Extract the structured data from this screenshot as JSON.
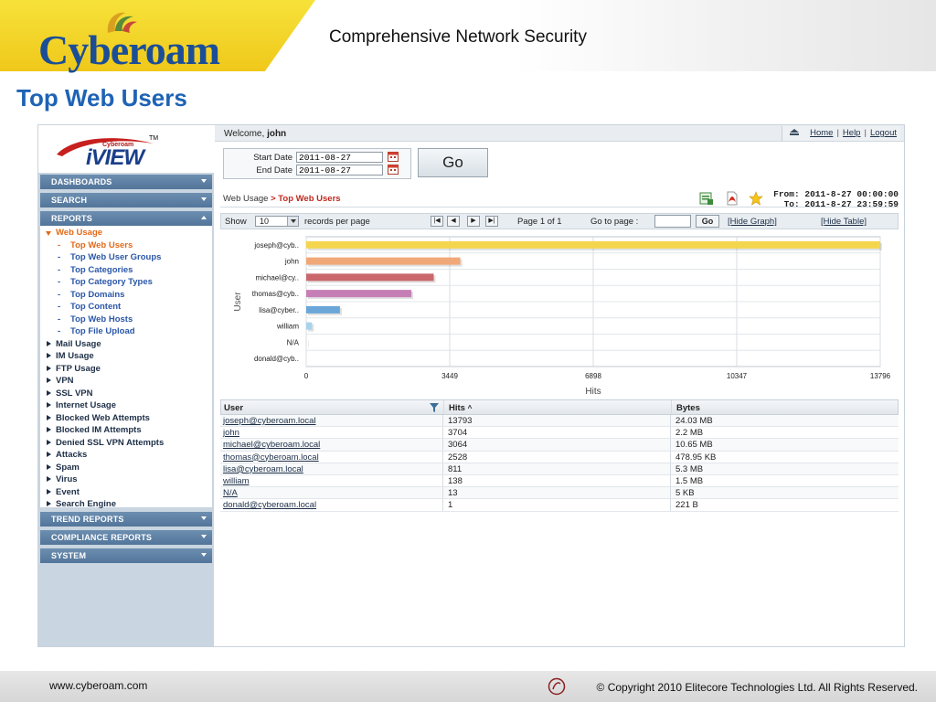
{
  "slide": {
    "brand": "Cyberoam",
    "tagline": "Comprehensive Network Security",
    "title": "Top Web Users",
    "footer_url": "www.cyberoam.com",
    "footer_copyright": "© Copyright 2010 Elitecore Technologies Ltd. All Rights Reserved.",
    "brand_color": "#1b4e97",
    "accent_color": "#efc81a"
  },
  "app": {
    "logo_small": "Cyberoam",
    "logo_main": "iVIEW",
    "logo_tm": "TM",
    "welcome_prefix": "Welcome, ",
    "user": "john",
    "links": {
      "home": "Home",
      "help": "Help",
      "logout": "Logout",
      "sep": "|"
    }
  },
  "sidebar": {
    "sections_top": [
      {
        "label": "DASHBOARDS"
      },
      {
        "label": "SEARCH"
      },
      {
        "label": "REPORTS"
      }
    ],
    "tree": [
      {
        "label": "Web Usage",
        "open": true
      },
      {
        "label": "Top Web Users",
        "sub": true,
        "active": true
      },
      {
        "label": "Top Web User Groups",
        "sub": true
      },
      {
        "label": "Top Categories",
        "sub": true
      },
      {
        "label": "Top Category Types",
        "sub": true
      },
      {
        "label": "Top Domains",
        "sub": true
      },
      {
        "label": "Top Content",
        "sub": true
      },
      {
        "label": "Top Web Hosts",
        "sub": true
      },
      {
        "label": "Top File Upload",
        "sub": true
      },
      {
        "label": "Mail Usage"
      },
      {
        "label": "IM Usage"
      },
      {
        "label": "FTP Usage"
      },
      {
        "label": "VPN"
      },
      {
        "label": "SSL VPN"
      },
      {
        "label": "Internet Usage"
      },
      {
        "label": "Blocked Web Attempts"
      },
      {
        "label": "Blocked IM Attempts"
      },
      {
        "label": "Denied SSL VPN Attempts"
      },
      {
        "label": "Attacks"
      },
      {
        "label": "Spam"
      },
      {
        "label": "Virus"
      },
      {
        "label": "Event"
      },
      {
        "label": "Search Engine"
      }
    ],
    "sections_bottom": [
      {
        "label": "TREND REPORTS"
      },
      {
        "label": "COMPLIANCE REPORTS"
      },
      {
        "label": "SYSTEM"
      }
    ],
    "dash": "-"
  },
  "filter": {
    "start_label": "Start Date",
    "start_value": "2011-08-27",
    "end_label": "End Date",
    "end_value": "2011-08-27",
    "go_label": "Go"
  },
  "report": {
    "breadcrumb_parent": "Web Usage",
    "breadcrumb_sep": " > ",
    "breadcrumb_current": "Top Web Users",
    "from_label": "From:",
    "from_value": "2011-8-27 00:00:00",
    "to_label": "To:",
    "to_value": "2011-8-27 23:59:59"
  },
  "pager": {
    "show_label": "Show",
    "records_value": "10",
    "records_label": "records per page",
    "page_info": "Page 1 of 1",
    "goto_label": "Go to page :",
    "go_label": "Go",
    "hide_graph": "[Hide Graph]",
    "hide_table": "[Hide Table]",
    "nav": [
      "|◀",
      "◀",
      "▶",
      "▶|"
    ]
  },
  "chart_data": {
    "type": "bar",
    "orientation": "horizontal",
    "categories": [
      "joseph@cyb..",
      "john",
      "michael@cy..",
      "thomas@cyb..",
      "lisa@cyber..",
      "william",
      "N/A",
      "donald@cyb.."
    ],
    "values": [
      13793,
      3704,
      3064,
      2528,
      811,
      138,
      13,
      1
    ],
    "colors": [
      "#f4d64e",
      "#f0a878",
      "#c9676a",
      "#c67fb6",
      "#6aa7d8",
      "#a8d2ee",
      "#dcdcdc",
      "#dcdcdc"
    ],
    "xlabel": "Hits",
    "ylabel": "User",
    "xlim": [
      0,
      13796
    ],
    "xticks": [
      "0",
      "3449",
      "6898",
      "10347",
      "13796"
    ],
    "grid": true
  },
  "table": {
    "columns": [
      "User",
      "Hits",
      "Bytes"
    ],
    "sort_indicator": "^",
    "rows": [
      [
        "joseph@cyberoam.local",
        "13793",
        "24.03 MB"
      ],
      [
        "john",
        "3704",
        "2.2 MB"
      ],
      [
        "michael@cyberoam.local",
        "3064",
        "10.65 MB"
      ],
      [
        "thomas@cyberoam.local",
        "2528",
        "478.95 KB"
      ],
      [
        "lisa@cyberoam.local",
        "811",
        "5.3 MB"
      ],
      [
        "william",
        "138",
        "1.5 MB"
      ],
      [
        "N/A",
        "13",
        "5 KB"
      ],
      [
        "donald@cyberoam.local",
        "1",
        "221 B"
      ]
    ]
  }
}
